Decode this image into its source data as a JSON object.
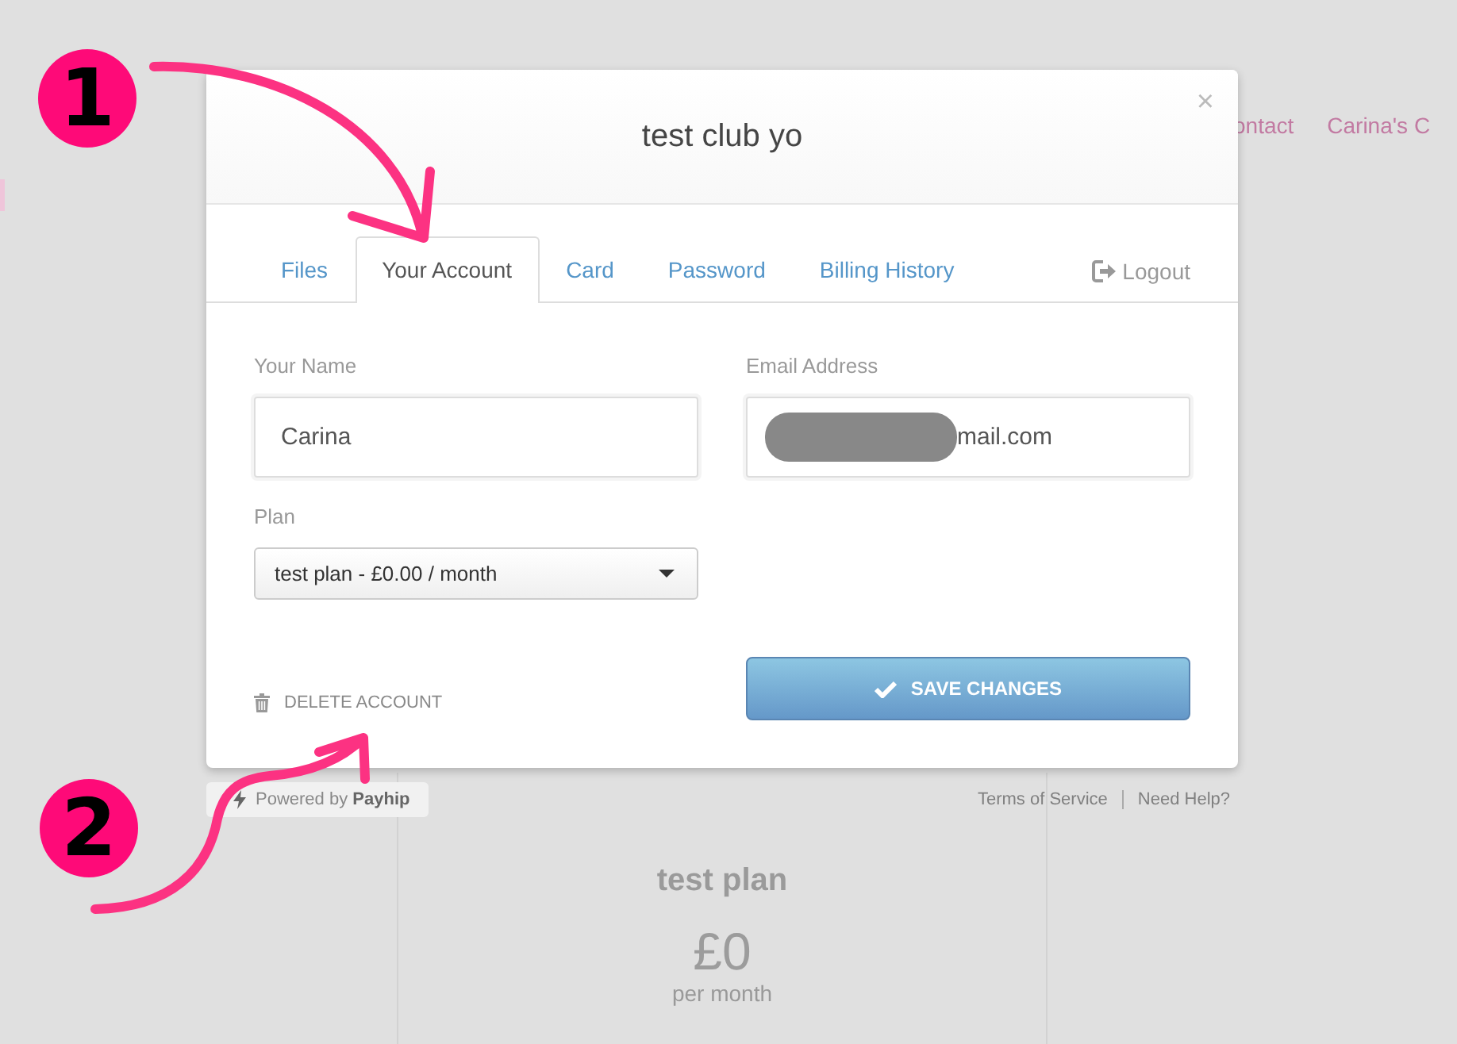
{
  "background_page": {
    "nav": [
      "ontact",
      "Carina's C"
    ],
    "plan_card": {
      "name": "test plan",
      "price": "£0",
      "period": "per month"
    }
  },
  "modal": {
    "title": "test club yo",
    "close": "×",
    "tabs": [
      {
        "label": "Files",
        "selected": false
      },
      {
        "label": "Your Account",
        "selected": true
      },
      {
        "label": "Card",
        "selected": false
      },
      {
        "label": "Password",
        "selected": false
      },
      {
        "label": "Billing History",
        "selected": false
      }
    ],
    "logout": "Logout",
    "fields": [
      {
        "label": "Your Name",
        "value": "Carina",
        "redacted": false
      },
      {
        "label": "Email Address",
        "value": "mail.com",
        "redacted": true
      }
    ],
    "plan": {
      "label": "Plan",
      "value": "test plan - £0.00 / month"
    },
    "delete": "DELETE ACCOUNT",
    "save": "SAVE CHANGES"
  },
  "footer": {
    "powered_by": "Powered by **Payhip**",
    "links": [
      "Terms of Service",
      "Need Help?"
    ]
  },
  "annotations": [
    {
      "label": "1"
    },
    {
      "label": "2"
    }
  ]
}
